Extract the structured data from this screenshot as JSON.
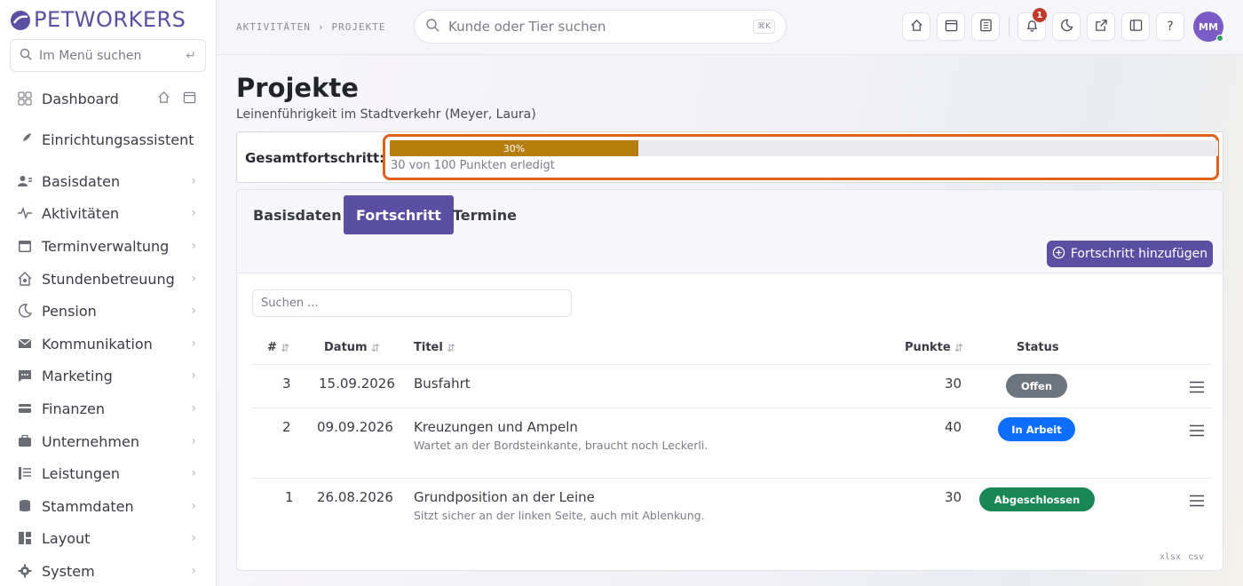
{
  "brand": {
    "name": "PETWORKERS",
    "color": "#5b4fa3"
  },
  "sidebar": {
    "search_placeholder": "Im Menü suchen",
    "items": [
      {
        "label": "Dashboard",
        "icon": "grid-icon"
      },
      {
        "label": "Einrichtungsassistent",
        "icon": "rocket-icon"
      },
      {
        "label": "Basisdaten",
        "icon": "users-icon"
      },
      {
        "label": "Aktivitäten",
        "icon": "activity-icon"
      },
      {
        "label": "Terminverwaltung",
        "icon": "calendar-icon"
      },
      {
        "label": "Stundenbetreuung",
        "icon": "house-heart-icon"
      },
      {
        "label": "Pension",
        "icon": "moon-icon"
      },
      {
        "label": "Kommunikation",
        "icon": "envelope-icon"
      },
      {
        "label": "Marketing",
        "icon": "chat-icon"
      },
      {
        "label": "Finanzen",
        "icon": "credit-card-icon"
      },
      {
        "label": "Unternehmen",
        "icon": "briefcase-icon"
      },
      {
        "label": "Leistungen",
        "icon": "list-icon"
      },
      {
        "label": "Stammdaten",
        "icon": "database-icon"
      },
      {
        "label": "Layout",
        "icon": "layout-icon"
      },
      {
        "label": "System",
        "icon": "gear-icon"
      }
    ]
  },
  "topbar": {
    "breadcrumb": [
      "AKTIVITÄTEN",
      "›",
      "PROJEKTE"
    ],
    "search_placeholder": "Kunde oder Tier suchen",
    "search_shortcut": "⌘K",
    "notification_count": "1",
    "user_initials": "MM"
  },
  "page": {
    "title": "Projekte",
    "subtitle": "Leinenführigkeit im Stadtverkehr (Meyer, Laura)"
  },
  "progress": {
    "label": "Gesamtfortschritt:",
    "percent": 30,
    "percent_label": "30%",
    "note": "30 von 100 Punkten erledigt",
    "fill_color": "#b57d0e",
    "highlight_color": "#e0611c"
  },
  "tabs": [
    {
      "label": "Basisdaten",
      "active": false
    },
    {
      "label": "Fortschritt",
      "active": true
    },
    {
      "label": "Termine",
      "active": false
    }
  ],
  "add_button_label": "Fortschritt hinzufügen",
  "table": {
    "search_placeholder": "Suchen ...",
    "columns": [
      "#",
      "Datum",
      "Titel",
      "Punkte",
      "Status"
    ],
    "rows": [
      {
        "nr": "3",
        "date": "15.09.2026",
        "title": "Busfahrt",
        "note": "",
        "points": "30",
        "status": "Offen",
        "status_color": "#6c757d"
      },
      {
        "nr": "2",
        "date": "09.09.2026",
        "title": "Kreuzungen und Ampeln",
        "note": "Wartet an der Bordsteinkante, braucht noch Leckerli.",
        "points": "40",
        "status": "In Arbeit",
        "status_color": "#0d6efd"
      },
      {
        "nr": "1",
        "date": "26.08.2026",
        "title": "Grundposition an der Leine",
        "note": "Sitzt sicher an der linken Seite, auch mit Ablenkung.",
        "points": "30",
        "status": "Abgeschlossen",
        "status_color": "#198754"
      }
    ],
    "export": [
      "xlsx",
      "csv"
    ]
  }
}
